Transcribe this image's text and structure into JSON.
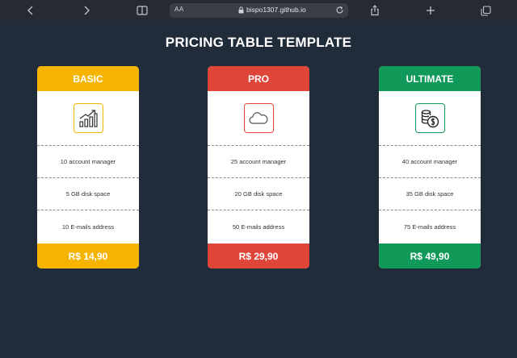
{
  "browser": {
    "text_size_label": "AA",
    "url": "bispo1307.github.io"
  },
  "page": {
    "title": "PRICING TABLE TEMPLATE"
  },
  "plans": [
    {
      "name": "BASIC",
      "icon": "growth-chart-icon",
      "color": "#f4b400",
      "features": [
        "10 account manager",
        "5 GB disk space",
        "10 E-mails address"
      ],
      "price": "R$ 14,90"
    },
    {
      "name": "PRO",
      "icon": "cloud-icon",
      "color": "#e0453a",
      "features": [
        "25 account manager",
        "20 GB disk space",
        "50 E-mails address"
      ],
      "price": "R$ 29,90"
    },
    {
      "name": "ULTIMATE",
      "icon": "coins-dollar-icon",
      "color": "#11995a",
      "features": [
        "40 account manager",
        "35 GB disk space",
        "75 E-mails address"
      ],
      "price": "R$ 49,90"
    }
  ]
}
